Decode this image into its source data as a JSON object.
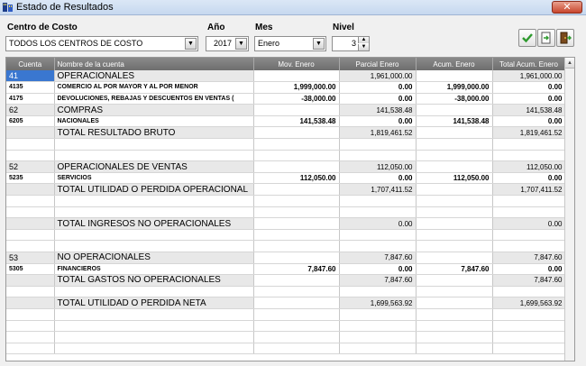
{
  "window": {
    "title": "Estado de Resultados",
    "close_label": "✕"
  },
  "filters": {
    "cost_center_label": "Centro de Costo",
    "cost_center_value": "TODOS LOS CENTROS DE COSTO",
    "year_label": "Año",
    "year_value": "2017",
    "month_label": "Mes",
    "month_value": "Enero",
    "level_label": "Nivel",
    "level_value": "3"
  },
  "grid": {
    "columns": [
      "Cuenta",
      "Nombre de la cuenta",
      "Mov. Enero",
      "Parcial Enero",
      "Acum. Enero",
      "Total Acum. Enero"
    ],
    "rows": [
      {
        "cuenta": "41",
        "nombre": "OPERACIONALES",
        "mov": "",
        "parcial": "1,961,000.00",
        "acum": "",
        "total": "1,961,000.00"
      },
      {
        "cuenta": "4135",
        "nombre": "COMERCIO AL POR MAYOR Y AL POR MENOR",
        "mov": "1,999,000.00",
        "parcial": "0.00",
        "acum": "1,999,000.00",
        "total": "0.00"
      },
      {
        "cuenta": "4175",
        "nombre": "DEVOLUCIONES, REBAJAS Y DESCUENTOS EN VENTAS (",
        "mov": "-38,000.00",
        "parcial": "0.00",
        "acum": "-38,000.00",
        "total": "0.00"
      },
      {
        "cuenta": "62",
        "nombre": "COMPRAS",
        "mov": "",
        "parcial": "141,538.48",
        "acum": "",
        "total": "141,538.48"
      },
      {
        "cuenta": "6205",
        "nombre": "NACIONALES",
        "mov": "141,538.48",
        "parcial": "0.00",
        "acum": "141,538.48",
        "total": "0.00"
      },
      {
        "cuenta": "",
        "nombre": "TOTAL RESULTADO BRUTO",
        "mov": "",
        "parcial": "1,819,461.52",
        "acum": "",
        "total": "1,819,461.52"
      },
      {
        "cuenta": "",
        "nombre": "",
        "mov": "",
        "parcial": "",
        "acum": "",
        "total": ""
      },
      {
        "cuenta": "",
        "nombre": "",
        "mov": "",
        "parcial": "",
        "acum": "",
        "total": ""
      },
      {
        "cuenta": "52",
        "nombre": "OPERACIONALES DE VENTAS",
        "mov": "",
        "parcial": "112,050.00",
        "acum": "",
        "total": "112,050.00"
      },
      {
        "cuenta": "5235",
        "nombre": "SERVICIOS",
        "mov": "112,050.00",
        "parcial": "0.00",
        "acum": "112,050.00",
        "total": "0.00"
      },
      {
        "cuenta": "",
        "nombre": "TOTAL UTILIDAD O PERDIDA OPERACIONAL",
        "mov": "",
        "parcial": "1,707,411.52",
        "acum": "",
        "total": "1,707,411.52"
      },
      {
        "cuenta": "",
        "nombre": "",
        "mov": "",
        "parcial": "",
        "acum": "",
        "total": ""
      },
      {
        "cuenta": "",
        "nombre": "",
        "mov": "",
        "parcial": "",
        "acum": "",
        "total": ""
      },
      {
        "cuenta": "",
        "nombre": "TOTAL INGRESOS NO OPERACIONALES",
        "mov": "",
        "parcial": "0.00",
        "acum": "",
        "total": "0.00"
      },
      {
        "cuenta": "",
        "nombre": "",
        "mov": "",
        "parcial": "",
        "acum": "",
        "total": ""
      },
      {
        "cuenta": "",
        "nombre": "",
        "mov": "",
        "parcial": "",
        "acum": "",
        "total": ""
      },
      {
        "cuenta": "53",
        "nombre": "NO OPERACIONALES",
        "mov": "",
        "parcial": "7,847.60",
        "acum": "",
        "total": "7,847.60"
      },
      {
        "cuenta": "5305",
        "nombre": "FINANCIEROS",
        "mov": "7,847.60",
        "parcial": "0.00",
        "acum": "7,847.60",
        "total": "0.00"
      },
      {
        "cuenta": "",
        "nombre": "TOTAL GASTOS NO OPERACIONALES",
        "mov": "",
        "parcial": "7,847.60",
        "acum": "",
        "total": "7,847.60"
      },
      {
        "cuenta": "",
        "nombre": "",
        "mov": "",
        "parcial": "",
        "acum": "",
        "total": ""
      },
      {
        "cuenta": "",
        "nombre": "TOTAL UTILIDAD O PERDIDA NETA",
        "mov": "",
        "parcial": "1,699,563.92",
        "acum": "",
        "total": "1,699,563.92"
      },
      {
        "cuenta": "",
        "nombre": "",
        "mov": "",
        "parcial": "",
        "acum": "",
        "total": ""
      },
      {
        "cuenta": "",
        "nombre": "",
        "mov": "",
        "parcial": "",
        "acum": "",
        "total": ""
      },
      {
        "cuenta": "",
        "nombre": "",
        "mov": "",
        "parcial": "",
        "acum": "",
        "total": ""
      },
      {
        "cuenta": "",
        "nombre": "",
        "mov": "",
        "parcial": "",
        "acum": "",
        "total": ""
      }
    ]
  },
  "colors": {
    "selection": "#3a77d0",
    "header": "#7c7c7c",
    "shaded_row": "#e8e8e8"
  }
}
